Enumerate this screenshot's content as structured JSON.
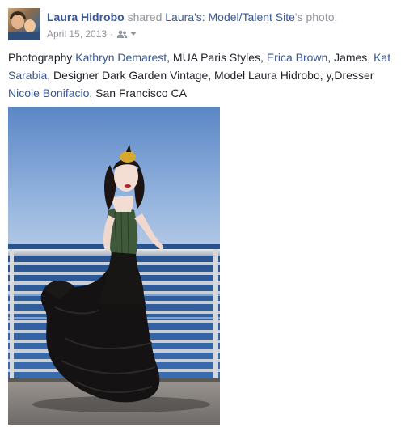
{
  "post": {
    "author": "Laura Hidrobo",
    "action_text": "shared",
    "shared_source": "Laura's: Model/Talent Site",
    "shared_suffix": "'s photo.",
    "date": "April 15, 2013",
    "separator": "·",
    "audience_icon": "friends-icon",
    "audience_dropdown_icon": "caret-down-icon",
    "caption": {
      "t1": "Photography ",
      "l1": "Kathryn Demarest",
      "t2": ", MUA Paris Styles, ",
      "l2": "Erica Brown",
      "t3": ", James, ",
      "l3": "Kat Sarabia",
      "t4": ", Designer Dark Garden Vintage, Model Laura Hidrobo, y,Dresser ",
      "l4": "Nicole Bonifacio",
      "t5": ", San Francisco CA"
    }
  },
  "colors": {
    "link": "#365899",
    "muted": "#90949c",
    "text": "#1d2129"
  }
}
